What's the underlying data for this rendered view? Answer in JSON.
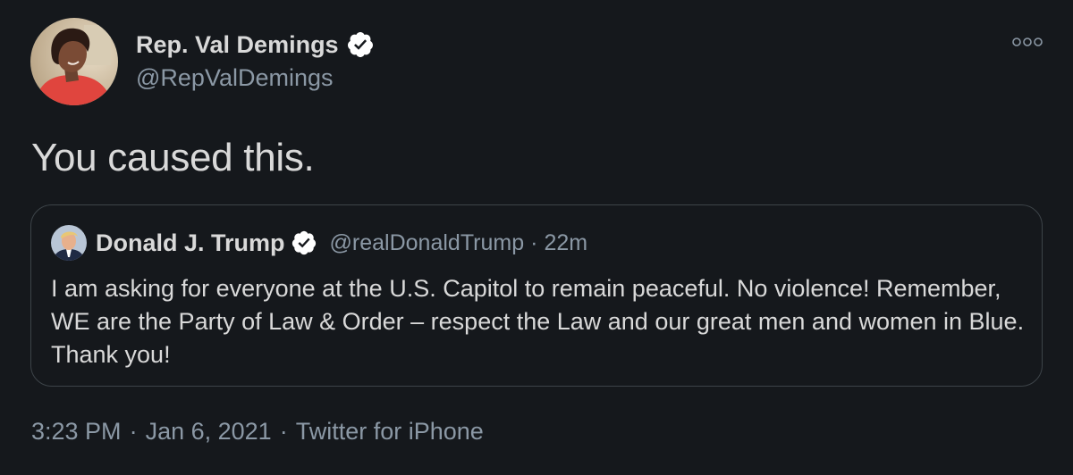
{
  "author": {
    "display_name": "Rep. Val Demings",
    "handle": "@RepValDemings",
    "avatar_icon": "profile-photo-icon",
    "verified_icon": "verified-badge-icon"
  },
  "more_icon": "more-options-icon",
  "tweet": {
    "text": "You caused this."
  },
  "quoted_tweet": {
    "display_name": "Donald J. Trump",
    "handle": "@realDonaldTrump",
    "separator": "·",
    "time": "22m",
    "text": "I am asking for everyone at the U.S. Capitol to remain peaceful. No violence! Remember, WE are the Party of Law & Order – respect the Law and our great men and women in Blue. Thank you!"
  },
  "meta": {
    "time": "3:23 PM",
    "separator": "·",
    "date": "Jan 6, 2021",
    "source": "Twitter for iPhone"
  },
  "colors": {
    "background": "#15181c",
    "primary_text": "#d9d9d9",
    "secondary_text": "#8b98a5",
    "border": "#3d4449"
  }
}
